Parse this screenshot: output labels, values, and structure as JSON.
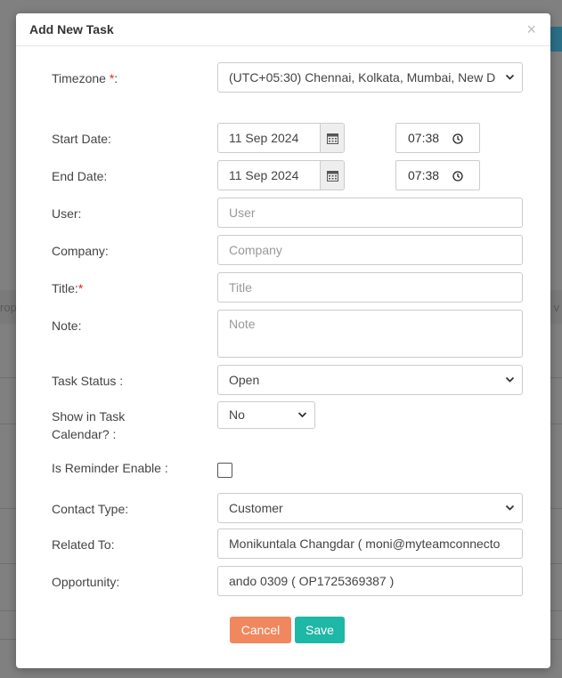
{
  "modal": {
    "title": "Add New Task",
    "close": "×"
  },
  "form": {
    "timezone": {
      "label": "Timezone ",
      "required_mark": "*",
      "colon": ":",
      "value": "(UTC+05:30) Chennai, Kolkata, Mumbai, New D"
    },
    "start_date": {
      "label": "Start Date:",
      "date": "11 Sep 2024",
      "time": "07:38"
    },
    "end_date": {
      "label": "End Date:",
      "date": "11 Sep 2024",
      "time": "07:38"
    },
    "user": {
      "label": "User:",
      "placeholder": "User"
    },
    "company": {
      "label": "Company:",
      "placeholder": "Company"
    },
    "title": {
      "label": "Title:",
      "required_mark": "*",
      "placeholder": "Title"
    },
    "note": {
      "label": "Note:",
      "placeholder": "Note"
    },
    "task_status": {
      "label": "Task Status :",
      "value": "Open"
    },
    "show_in_calendar": {
      "label_line1": "Show in Task",
      "label_line2": "Calendar? :",
      "value": "No"
    },
    "reminder": {
      "label": "Is Reminder Enable :",
      "checked": false
    },
    "contact_type": {
      "label": "Contact Type:",
      "value": "Customer"
    },
    "related_to": {
      "label": "Related To:",
      "value": "Monikuntala Changdar ( moni@myteamconnecto"
    },
    "opportunity": {
      "label": "Opportunity:",
      "value": "ando 0309 ( OP1725369387 )"
    }
  },
  "buttons": {
    "cancel": "Cancel",
    "save": "Save"
  },
  "colors": {
    "cancel": "#f0875f",
    "save": "#1fb7a6",
    "required": "#e02424"
  }
}
